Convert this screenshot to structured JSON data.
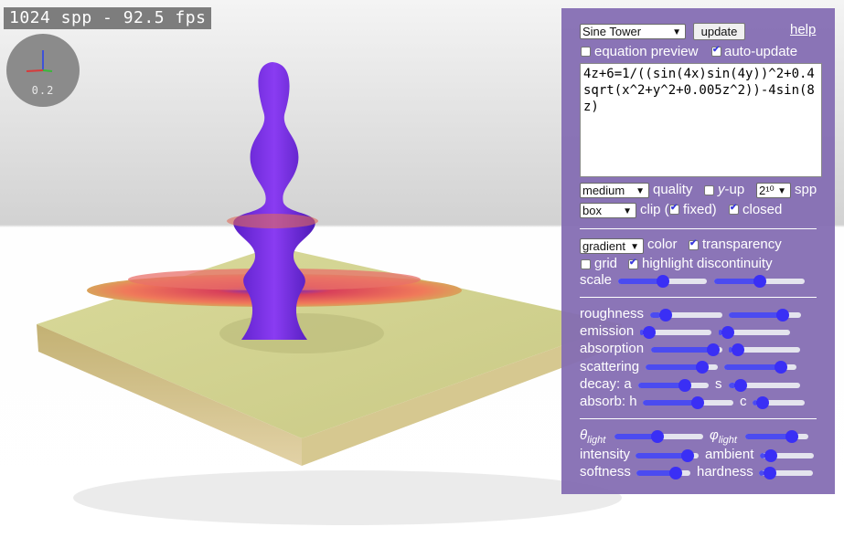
{
  "overlay": {
    "stats": "1024 spp - 92.5 fps",
    "axis_scale": "0.2"
  },
  "panel": {
    "preset": "Sine Tower",
    "update_button": "update",
    "help": "help",
    "equation_preview": {
      "label": "equation preview",
      "checked": false
    },
    "auto_update": {
      "label": "auto-update",
      "checked": true
    },
    "equation": "4z+6=1/((sin(4x)sin(4y))^2+0.4sqrt(x^2+y^2+0.005z^2))-4sin(8z)",
    "quality": {
      "value": "medium",
      "label": "quality"
    },
    "y_up": {
      "checked": false,
      "label_italic": "y",
      "label_rest": "-up"
    },
    "spp": {
      "value": "2¹⁰",
      "label": "spp"
    },
    "clip": {
      "value": "box",
      "label": "clip ("
    },
    "fixed": {
      "label": "fixed)",
      "checked": true
    },
    "closed": {
      "label": "closed",
      "checked": true
    },
    "color": {
      "value": "gradient",
      "label": "color"
    },
    "transparency": {
      "label": "transparency",
      "checked": true
    },
    "grid": {
      "label": "grid",
      "checked": false
    },
    "highlight_discontinuity": {
      "label": "highlight discontinuity",
      "checked": true
    },
    "sliders": {
      "scale": {
        "label": "scale",
        "a": 0.5,
        "b": 0.5
      },
      "roughness": {
        "label": "roughness",
        "a": 0.15,
        "b": 0.8
      },
      "emission": {
        "label": "emission",
        "a": 0.05,
        "b": 0.05
      },
      "absorption": {
        "label": "absorption",
        "a": 0.95,
        "b": 0.05
      },
      "scattering": {
        "label": "scattering",
        "a": 0.85,
        "b": 0.85
      },
      "decay": {
        "label": "decay: a",
        "label_b": "s",
        "a": 0.7,
        "b": 0.1
      },
      "absorb": {
        "label": "absorb: h",
        "label_b": "c",
        "a": 0.62,
        "b": 0.1
      },
      "theta": {
        "label": "θ",
        "sub": "light",
        "a": 0.48
      },
      "phi": {
        "label": "φ",
        "sub": "light",
        "a": 0.8
      },
      "intensity": {
        "label": "intensity",
        "a": 0.9
      },
      "ambient": {
        "label": "ambient",
        "a": 0.1
      },
      "softness": {
        "label": "softness",
        "a": 0.8
      },
      "hardness": {
        "label": "hardness",
        "a": 0.1
      }
    }
  },
  "colors": {
    "panel": "#846cb2",
    "slider_fill": "#3a2ff5",
    "tower": "#7a2fe8",
    "base": "#cfcf8a"
  }
}
